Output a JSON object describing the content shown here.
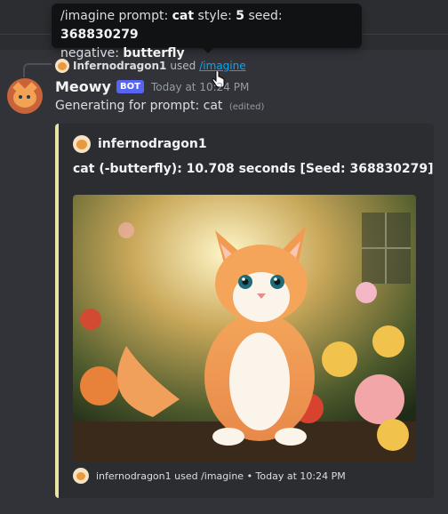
{
  "tooltip": {
    "line1_prefix": "/imagine prompt:",
    "prompt": "cat",
    "style_label": "style:",
    "style": "5",
    "seed_label": "seed:",
    "seed": "368830279",
    "negative_label": "negative:",
    "negative": "butterfly"
  },
  "reply": {
    "user": "Infernodragon1",
    "used": "used",
    "command": "/imagine"
  },
  "message": {
    "author": "Meowy",
    "bot_tag": "BOT",
    "timestamp": "Today at 10:24 PM",
    "content": "Generating for prompt: cat",
    "edited": "(edited)"
  },
  "embed": {
    "author": "infernodragon1",
    "title": "cat (-butterfly): 10.708 seconds [Seed: 368830279]",
    "footer": "infernodragon1 used /imagine • Today at 10:24 PM",
    "accent_color": "#e8e3a7",
    "image_description_icon": "generated-cat-image"
  }
}
